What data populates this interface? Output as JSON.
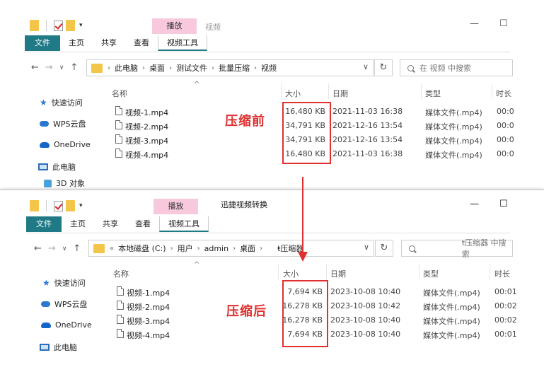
{
  "top": {
    "title_app": "视频",
    "ctx_tab": "播放",
    "ribbon": [
      "文件",
      "主页",
      "共享",
      "查看",
      "视频工具"
    ],
    "address": [
      "此电脑",
      "桌面",
      "测试文件",
      "批量压缩",
      "视频"
    ],
    "search_placeholder": "在 视频 中搜索",
    "headers": {
      "name": "名称",
      "size": "大小",
      "date": "日期",
      "type": "类型",
      "duration": "时长"
    },
    "sidebar": [
      "快速访问",
      "WPS云盘",
      "OneDrive",
      "此电脑",
      "3D 对象"
    ],
    "annotation": "压缩前",
    "rows": [
      {
        "name": "视频-1.mp4",
        "size": "16,480 KB",
        "date": "2021-11-03 16:38",
        "type": "媒体文件(.mp4)",
        "duration": "00:0"
      },
      {
        "name": "视频-2.mp4",
        "size": "34,791 KB",
        "date": "2021-12-16 13:54",
        "type": "媒体文件(.mp4)",
        "duration": "00:0"
      },
      {
        "name": "视频-3.mp4",
        "size": "34,791 KB",
        "date": "2021-12-16 13:54",
        "type": "媒体文件(.mp4)",
        "duration": "00:0"
      },
      {
        "name": "视频-4.mp4",
        "size": "16,480 KB",
        "date": "2021-11-03 16:38",
        "type": "媒体文件(.mp4)",
        "duration": "00:0"
      }
    ]
  },
  "bottom": {
    "title_app": "迅捷视频转换",
    "ctx_tab": "播放",
    "ribbon": [
      "文件",
      "主页",
      "共享",
      "查看",
      "视频工具"
    ],
    "address_prefix": "«",
    "address": [
      "本地磁盘 (C:)",
      "用户",
      "admin",
      "桌面",
      "ŧ压缩器"
    ],
    "search_placeholder": "ŧ压缩器 中搜索",
    "headers": {
      "name": "名称",
      "size": "大小",
      "date": "日期",
      "type": "类型",
      "duration": "时长"
    },
    "sidebar": [
      "快速访问",
      "WPS云盘",
      "OneDrive",
      "此电脑"
    ],
    "annotation": "压缩后",
    "rows": [
      {
        "name": "视频-1.mp4",
        "size": "7,694 KB",
        "date": "2023-10-08 10:40",
        "type": "媒体文件(.mp4)",
        "duration": "00:01"
      },
      {
        "name": "视频-2.mp4",
        "size": "16,278 KB",
        "date": "2023-10-08 10:42",
        "type": "媒体文件(.mp4)",
        "duration": "00:02"
      },
      {
        "name": "视频-3.mp4",
        "size": "16,278 KB",
        "date": "2023-10-08 10:40",
        "type": "媒体文件(.mp4)",
        "duration": "00:02"
      },
      {
        "name": "视频-4.mp4",
        "size": "7,694 KB",
        "date": "2023-10-08 10:40",
        "type": "媒体文件(.mp4)",
        "duration": "00:01"
      }
    ]
  },
  "icons": {
    "nav": [
      "back-arrow-icon",
      "forward-arrow-icon",
      "recent-dropdown-icon",
      "up-arrow-icon"
    ],
    "window": [
      "minimize-icon",
      "maximize-icon"
    ]
  },
  "colors": {
    "file_tab": "#1f7a85",
    "context_tab": "#f8c8dc",
    "annotation_red": "#e03030"
  }
}
